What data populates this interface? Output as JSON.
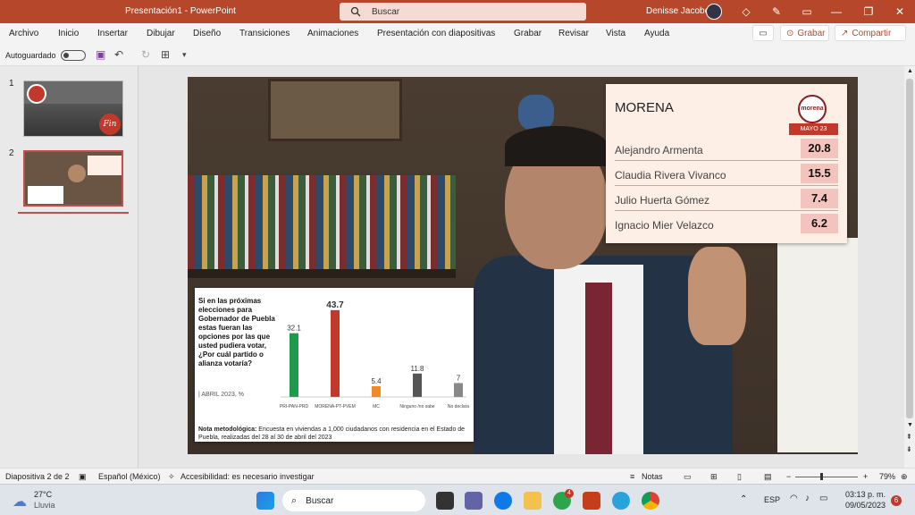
{
  "window": {
    "doc_title": "Presentación1 - PowerPoint",
    "search_placeholder": "Buscar",
    "user_name": "Denisse Jacobo"
  },
  "ribbon": {
    "tabs": [
      "Archivo",
      "Inicio",
      "Insertar",
      "Dibujar",
      "Diseño",
      "Transiciones",
      "Animaciones",
      "Presentación con diapositivas",
      "Grabar",
      "Revisar",
      "Vista",
      "Ayuda"
    ],
    "record_label": "Grabar",
    "share_label": "Compartir"
  },
  "qat": {
    "autosave_label": "Autoguardado"
  },
  "thumbnails": {
    "slide1_num": "1",
    "slide2_num": "2",
    "slide1_text": "Fin"
  },
  "slide": {
    "morena": {
      "title": "MORENA",
      "logo_text": "morena",
      "month_label": "MAYO 23",
      "rows": [
        {
          "name": "Alejandro Armenta",
          "value": "20.8"
        },
        {
          "name": "Claudia Rivera Vivanco",
          "value": "15.5"
        },
        {
          "name": "Julio Huerta Gómez",
          "value": "7.4"
        },
        {
          "name": "Ignacio Mier Velazco",
          "value": "6.2"
        }
      ]
    },
    "poll": {
      "question": "Si en las próximas elecciones para Gobernador de Puebla estas fueran las opciones por las que usted pudiera votar, ¿Por cuál partido o alianza votaría?",
      "date": "| ABRIL 2023, %",
      "note_label": "Nota metodológica:",
      "note_text": "Encuesta en viviendas a 1,000 ciudadanos con residencia en el Estado de Puebla, realizadas del 28 al 30 de abril del 2023"
    }
  },
  "chart_data": {
    "type": "bar",
    "categories": [
      "PRI-PAN-PRD",
      "MORENA-PT-PVEM",
      "MC",
      "Ninguno /no sabe",
      "No declara"
    ],
    "values": [
      32.1,
      43.7,
      5.4,
      11.8,
      7
    ],
    "value_labels": [
      "32.1",
      "43.7",
      "5.4",
      "11.8",
      "7"
    ],
    "colors": [
      "#1f9a4a",
      "#c0392b",
      "#f08a24",
      "#555555",
      "#888888"
    ],
    "title": "",
    "ylim": [
      0,
      45
    ]
  },
  "statusbar": {
    "slide_info": "Diapositiva 2 de 2",
    "language": "Español (México)",
    "accessibility": "Accesibilidad: es necesario investigar",
    "notes_label": "Notas",
    "zoom": "79%"
  },
  "taskbar": {
    "weather_temp": "27°C",
    "weather_desc": "Lluvia",
    "search_label": "Buscar",
    "lang": "ESP",
    "time": "03:13 p. m.",
    "date": "09/05/2023",
    "notif_count": "6",
    "teams_badge": "4"
  },
  "icons": [
    "search-icon",
    "diamond-icon",
    "pen-icon",
    "restore-icon",
    "minimize-icon",
    "maximize-icon",
    "close-icon",
    "comment-icon",
    "save-icon",
    "undo-icon",
    "redo-icon",
    "present-icon",
    "windows-icon",
    "edge-icon",
    "folder-icon",
    "chrome-icon",
    "powerpoint-icon",
    "telegram-icon",
    "wifi-icon",
    "volume-icon",
    "battery-icon"
  ]
}
